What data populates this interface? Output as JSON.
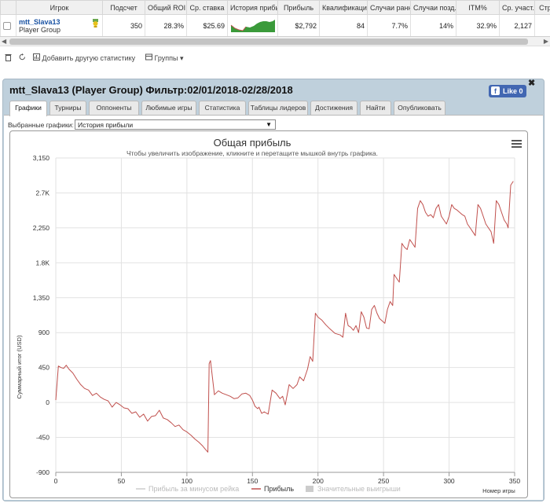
{
  "table": {
    "headers": [
      "Игрок",
      "Подсчет",
      "Общий ROI",
      "Ср. ставка",
      "История прибыли",
      "Прибыль",
      "Квалификация",
      "Случаи ранних",
      "Случаи позд...",
      "ITM%",
      "Ср. участ...",
      "Стра"
    ],
    "row": {
      "name": "mtt_Slava13",
      "group": "Player Group",
      "count": "350",
      "roi": "28.3%",
      "avg_stake": "$25.69",
      "profit": "$2,792",
      "qualification": "84",
      "early": "7.7%",
      "late": "14%",
      "itm": "32.9%",
      "avg_field": "2,127"
    }
  },
  "toolbar": {
    "add_stat": "Добавить другую статистику",
    "groups": "Группы"
  },
  "panel": {
    "title": "mtt_Slava13 (Player Group) Фильтр:02/01/2018-02/28/2018",
    "like": "Like 0",
    "tabs": [
      "Графики",
      "Турниры",
      "Оппоненты",
      "Любимые игры",
      "Статистика",
      "Таблицы лидеров",
      "Достижения",
      "Найти",
      "Опубликовать"
    ],
    "select_label": "Выбранные графики:",
    "select_value": "История прибыли"
  },
  "colors": {
    "profit_line": "#c0504d",
    "sparkline": "#3a9a3a",
    "accent": "#4267b2"
  },
  "icons": [
    "checkbox-icon",
    "trophy-icon",
    "trash-icon",
    "refresh-icon",
    "chart-icon",
    "groups-icon",
    "menu-icon",
    "close-icon"
  ],
  "chart_data": {
    "type": "line",
    "title": "Общая прибыль",
    "subtitle": "Чтобы увеличить изображение, кликните и перетащите мышкой внутрь графика.",
    "xlabel": "Номер игры",
    "ylabel": "Суммарный итог (USD)",
    "xlim": [
      0,
      350
    ],
    "ylim": [
      -900,
      3150
    ],
    "xticks": [
      "0",
      "50",
      "100",
      "150",
      "200",
      "250",
      "300",
      "350"
    ],
    "yticks": [
      "3,150",
      "2.7K",
      "2,250",
      "1.8K",
      "1,350",
      "900",
      "450",
      "0",
      "-450",
      "-900"
    ],
    "grid": true,
    "legend_position": "bottom",
    "legend": [
      {
        "name": "Прибыль за минусом рейка",
        "active": false
      },
      {
        "name": "Прибыль",
        "active": true
      },
      {
        "name": "Значительные выигрыши",
        "active": false
      }
    ],
    "series": [
      {
        "name": "Прибыль",
        "x": [
          0,
          2,
          4,
          6,
          8,
          10,
          13,
          16,
          19,
          22,
          25,
          28,
          31,
          34,
          37,
          40,
          43,
          46,
          49,
          52,
          55,
          58,
          61,
          64,
          67,
          70,
          73,
          76,
          79,
          82,
          85,
          88,
          91,
          94,
          97,
          100,
          103,
          106,
          109,
          112,
          114,
          116,
          117,
          118,
          121,
          124,
          127,
          130,
          133,
          136,
          139,
          142,
          145,
          148,
          150,
          152,
          154,
          155,
          157,
          159,
          162,
          165,
          168,
          171,
          173,
          175,
          178,
          181,
          184,
          186,
          189,
          192,
          194,
          196,
          198,
          200,
          203,
          206,
          209,
          211,
          213,
          215,
          217,
          219,
          221,
          223,
          225,
          227,
          229,
          231,
          233,
          235,
          237,
          239,
          241,
          243,
          245,
          247,
          249,
          251,
          253,
          255,
          257,
          258,
          260,
          262,
          264,
          266,
          268,
          270,
          272,
          274,
          276,
          278,
          280,
          282,
          284,
          286,
          288,
          290,
          292,
          294,
          296,
          298,
          300,
          302,
          304,
          306,
          308,
          310,
          312,
          314,
          316,
          318,
          320,
          322,
          324,
          326,
          328,
          330,
          332,
          334,
          336,
          338,
          340,
          342,
          344,
          345,
          347,
          349
        ],
        "values": [
          30,
          470,
          450,
          440,
          480,
          430,
          380,
          300,
          230,
          180,
          160,
          90,
          120,
          70,
          40,
          20,
          -60,
          0,
          -30,
          -70,
          -80,
          -140,
          -120,
          -190,
          -150,
          -240,
          -180,
          -170,
          -100,
          -200,
          -220,
          -260,
          -310,
          -290,
          -350,
          -380,
          -420,
          -470,
          -510,
          -560,
          -600,
          -640,
          500,
          540,
          100,
          150,
          120,
          100,
          80,
          50,
          60,
          110,
          120,
          90,
          30,
          -50,
          -80,
          -60,
          -140,
          -120,
          -150,
          160,
          120,
          50,
          80,
          -30,
          230,
          180,
          230,
          330,
          280,
          430,
          590,
          530,
          1150,
          1100,
          1060,
          1000,
          950,
          920,
          890,
          880,
          870,
          840,
          1150,
          990,
          970,
          930,
          990,
          900,
          1170,
          1100,
          960,
          950,
          1200,
          1250,
          1150,
          1080,
          1050,
          1020,
          1200,
          1300,
          1250,
          1650,
          1600,
          1550,
          2050,
          2000,
          1970,
          2100,
          2050,
          2000,
          2500,
          2600,
          2550,
          2450,
          2400,
          2420,
          2380,
          2500,
          2550,
          2400,
          2350,
          2300,
          2400,
          2550,
          2500,
          2480,
          2450,
          2420,
          2400,
          2300,
          2250,
          2200,
          2150,
          2550,
          2500,
          2400,
          2300,
          2250,
          2200,
          2050,
          2600,
          2550,
          2450,
          2350,
          2300,
          2250,
          2800,
          2850
        ]
      }
    ]
  }
}
